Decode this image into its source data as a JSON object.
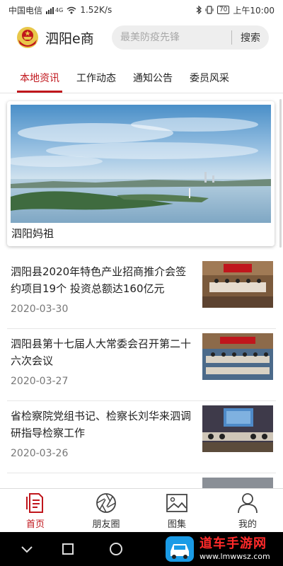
{
  "status_bar": {
    "carrier": "中国电信",
    "network": "4G",
    "speed": "1.52K/s",
    "battery": "70",
    "time": "上午10:00"
  },
  "header": {
    "logo_icon": "emblem-icon",
    "title": "泗阳e商",
    "search": {
      "placeholder": "最美防疫先锋",
      "button_label": "搜索"
    }
  },
  "tabs": [
    {
      "label": "本地资讯",
      "active": true
    },
    {
      "label": "工作动态",
      "active": false
    },
    {
      "label": "通知公告",
      "active": false
    },
    {
      "label": "委员风采",
      "active": false
    }
  ],
  "featured": {
    "caption": "泗阳妈祖"
  },
  "news": [
    {
      "title": "泗阳县2020年特色产业招商推介会签约项目19个 投资总额达160亿元",
      "date": "2020-03-30"
    },
    {
      "title": "泗阳县第十七届人大常委会召开第二十六次会议",
      "date": "2020-03-27"
    },
    {
      "title": "省检察院党组书记、检察长刘华来泗调研指导检察工作",
      "date": "2020-03-26"
    }
  ],
  "bottom_nav": [
    {
      "label": "首页",
      "icon": "home-document-icon",
      "active": true
    },
    {
      "label": "朋友圈",
      "icon": "camera-aperture-icon",
      "active": false
    },
    {
      "label": "图集",
      "icon": "image-gallery-icon",
      "active": false
    },
    {
      "label": "我的",
      "icon": "user-profile-icon",
      "active": false
    }
  ],
  "watermark": {
    "title": "道车手游网",
    "url": "www.lmwwsz.com"
  },
  "colors": {
    "accent": "#c0161c"
  }
}
